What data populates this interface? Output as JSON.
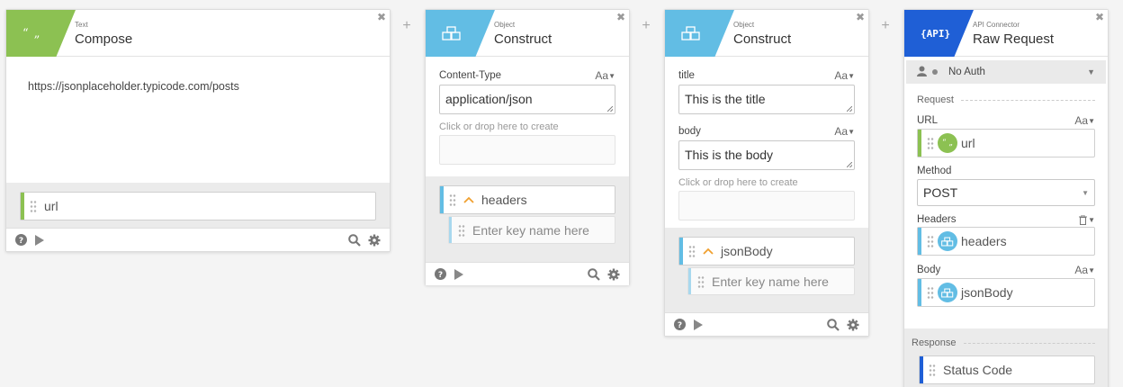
{
  "colors": {
    "text_badge": "#8cc152",
    "object_badge": "#62bde4",
    "api_badge": "#1f5fd6",
    "url_bar": "#8cc152",
    "object_bar": "#62bde4",
    "status_bar": "#1f5fd6"
  },
  "cards": {
    "compose": {
      "type": "Text",
      "title": "Compose",
      "text_value": "https://jsonplaceholder.typicode.com/posts",
      "output_label": "url"
    },
    "construct1": {
      "type": "Object",
      "title": "Construct",
      "field_label": "Content-Type",
      "field_value": "application/json",
      "drop_hint": "Click or drop here to create",
      "output_label": "headers",
      "key_placeholder": "Enter key name here"
    },
    "construct2": {
      "type": "Object",
      "title": "Construct",
      "field1_label": "title",
      "field1_value": "This is the title",
      "field2_label": "body",
      "field2_value": "This is the body",
      "drop_hint": "Click or drop here to create",
      "output_label": "jsonBody",
      "key_placeholder": "Enter key name here"
    },
    "api": {
      "type": "API Connector",
      "title": "Raw Request",
      "auth": "No Auth",
      "request_section": "Request",
      "url_label": "URL",
      "url_value": "url",
      "method_label": "Method",
      "method_value": "POST",
      "headers_label": "Headers",
      "headers_value": "headers",
      "body_label": "Body",
      "body_value": "jsonBody",
      "response_section": "Response",
      "status_label": "Status Code"
    }
  },
  "common": {
    "close": "✖",
    "plus": "+",
    "aa": "Aa",
    "api_badge_text": "{API}",
    "quote_glyph": "“ „"
  }
}
